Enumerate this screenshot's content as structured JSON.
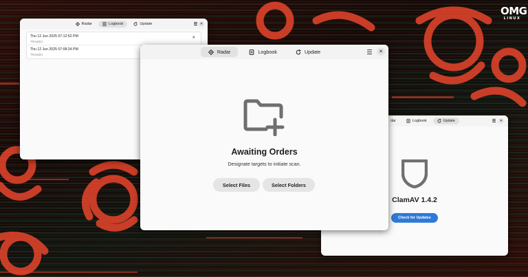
{
  "brand": {
    "logo_main": "OMG",
    "logo_sub": "LINUX"
  },
  "colors": {
    "accent": "#2f7ad8",
    "bg_symbol": "#e8452c"
  },
  "window_logbook": {
    "tabs": [
      {
        "label": "Radar",
        "icon": "radar-icon"
      },
      {
        "label": "Logbook",
        "icon": "logbook-icon",
        "active": true
      },
      {
        "label": "Update",
        "icon": "refresh-icon"
      }
    ],
    "entries": [
      {
        "date": "Thu 12 Jun 2025 07:12:52 PM",
        "status": "Threat(s)"
      },
      {
        "date": "Thu 12 Jun 2025 07:08:24 PM",
        "status": "Threat(s)"
      }
    ]
  },
  "window_radar": {
    "tabs": [
      {
        "label": "Radar",
        "icon": "radar-icon",
        "active": true
      },
      {
        "label": "Logbook",
        "icon": "logbook-icon"
      },
      {
        "label": "Update",
        "icon": "refresh-icon"
      }
    ],
    "title": "Awaiting Orders",
    "subtitle": "Designate targets to initiate scan.",
    "select_files": "Select Files",
    "select_folders": "Select Folders"
  },
  "window_update": {
    "tabs": [
      {
        "label": "dar",
        "icon": "radar-icon"
      },
      {
        "label": "Logbook",
        "icon": "logbook-icon"
      },
      {
        "label": "Update",
        "icon": "refresh-icon",
        "active": true
      }
    ],
    "version_title": "ClamAV 1.4.2",
    "check_button": "Check for Updates"
  }
}
